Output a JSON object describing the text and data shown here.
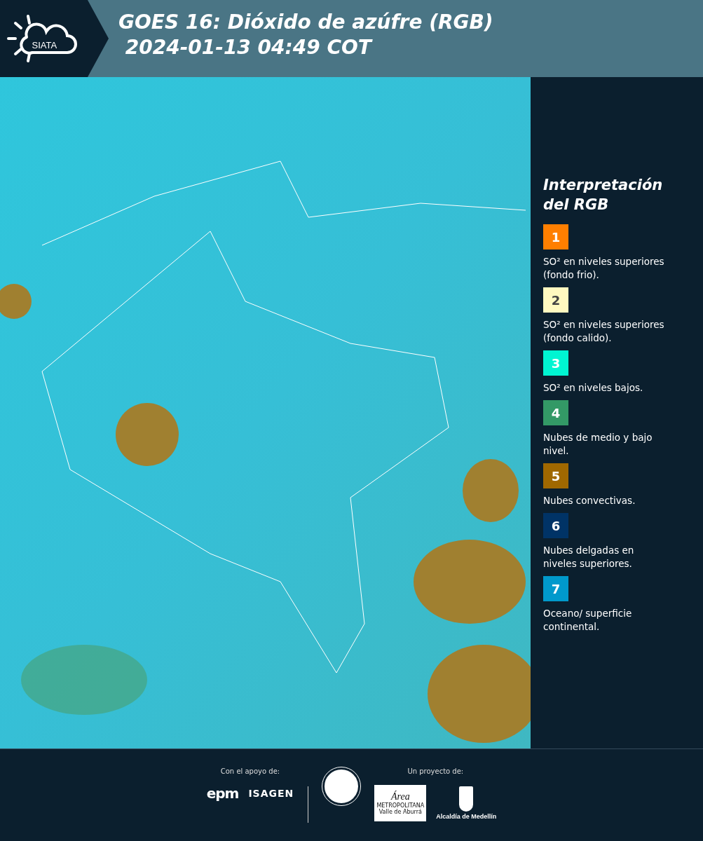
{
  "header": {
    "logo": "SIATA",
    "title": "GOES 16: Dióxido de azúfre (RGB)",
    "subtitle": "2024-01-13 04:49 COT"
  },
  "legend": {
    "title": "Interpretación del RGB",
    "items": [
      {
        "number": "1",
        "color": "#ff7f00",
        "text": "SO² en niveles superiores (fondo frio)."
      },
      {
        "number": "2",
        "color": "#fff9c0",
        "text": "SO² en niveles superiores (fondo calido)."
      },
      {
        "number": "3",
        "color": "#00f5d2",
        "text": "SO² en niveles bajos."
      },
      {
        "number": "4",
        "color": "#339966",
        "text": "Nubes de medio y bajo nivel."
      },
      {
        "number": "5",
        "color": "#a06800",
        "text": "Nubes convectivas."
      },
      {
        "number": "6",
        "color": "#003366",
        "text": "Nubes delgadas en niveles superiores."
      },
      {
        "number": "7",
        "color": "#0099cc",
        "text": "Oceano/ superficie continental."
      }
    ]
  },
  "footer": {
    "support_label": "Con el apoyo de:",
    "support_logos": [
      "epm",
      "ISAGEN"
    ],
    "project_label": "Un proyecto de:",
    "area_logo": {
      "title": "Área",
      "subtitle": "METROPOLITANA Valle de Aburrá"
    },
    "alcaldia_logo": "Alcaldía de Medellín"
  }
}
